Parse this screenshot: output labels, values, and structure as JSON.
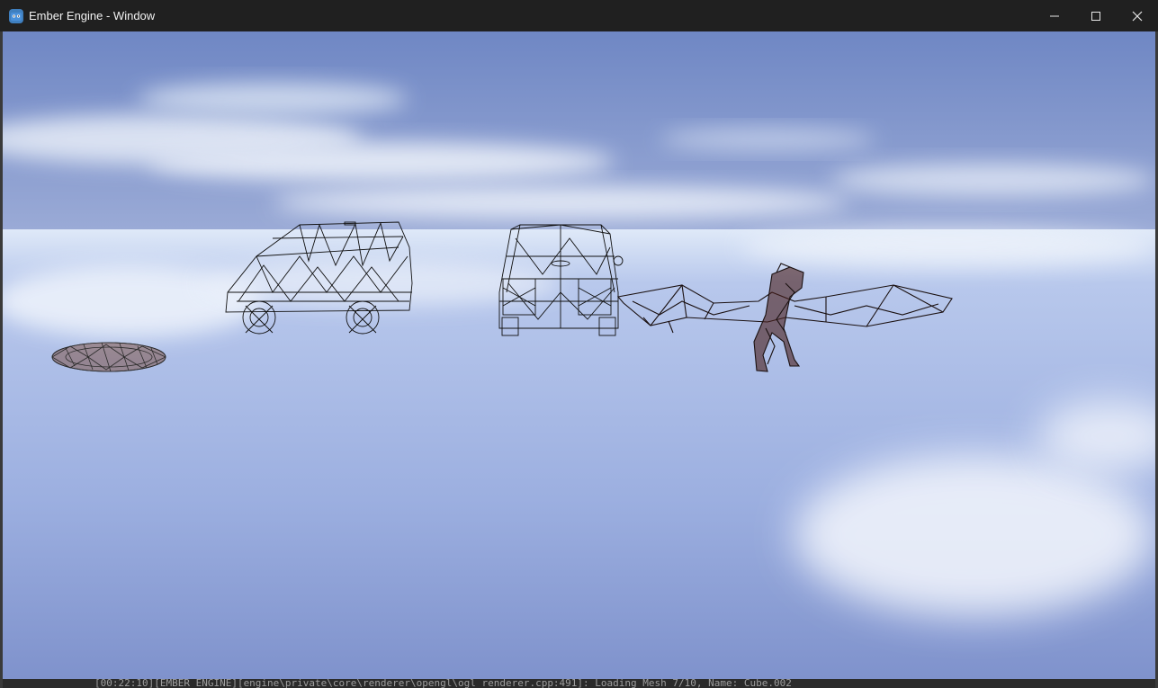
{
  "window": {
    "title": "Ember Engine - Window",
    "icon": "godot-robot-icon",
    "controls": {
      "minimize_icon": "minimize-icon",
      "maximize_icon": "maximize-icon",
      "close_icon": "close-icon"
    }
  },
  "viewport": {
    "scene_objects": [
      {
        "name": "flat-ring-mesh",
        "style": "wireframe"
      },
      {
        "name": "car-mesh-side",
        "style": "wireframe"
      },
      {
        "name": "van-mesh-front",
        "style": "wireframe"
      },
      {
        "name": "dragon-mesh",
        "style": "wireframe"
      }
    ],
    "sky_colors": {
      "top": "#7b8fc7",
      "horizon": "#e9f1fb",
      "bottom": "#8799cf"
    }
  },
  "console": {
    "log_line": "[00:22:10][EMBER_ENGINE][engine\\private\\core\\renderer\\opengl\\ogl_renderer.cpp:491]: Loading Mesh 7/10, Name: Cube.002"
  }
}
